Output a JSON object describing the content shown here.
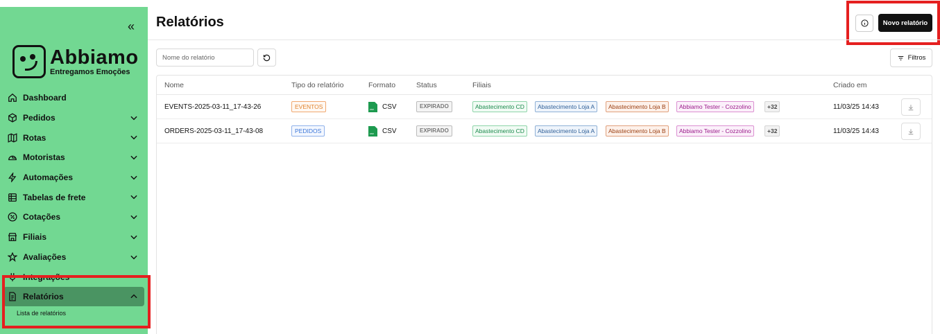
{
  "sidebar": {
    "brand": {
      "name": "Abbiamo",
      "tagline": "Entregamos Emoções"
    },
    "items": [
      {
        "label": "Dashboard",
        "icon": "home-icon"
      },
      {
        "label": "Pedidos",
        "icon": "package-icon"
      },
      {
        "label": "Rotas",
        "icon": "map-icon"
      },
      {
        "label": "Motoristas",
        "icon": "helmet-icon"
      },
      {
        "label": "Automações",
        "icon": "lightning-icon"
      },
      {
        "label": "Tabelas de frete",
        "icon": "table-icon"
      },
      {
        "label": "Cotações",
        "icon": "percent-icon"
      },
      {
        "label": "Filiais",
        "icon": "store-icon"
      },
      {
        "label": "Avaliações",
        "icon": "star-icon"
      },
      {
        "label": "Integrações",
        "icon": "plug-icon"
      },
      {
        "label": "Relatórios",
        "icon": "document-icon"
      }
    ],
    "subitem": "Lista de relatórios"
  },
  "header": {
    "title": "Relatórios",
    "new_button": "Novo relatório"
  },
  "toolbar": {
    "search_placeholder": "Nome do relatório",
    "filters_label": "Filtros"
  },
  "table": {
    "columns": [
      "Nome",
      "Tipo do relatório",
      "Formato",
      "Status",
      "Filiais",
      "Criado em"
    ],
    "rows": [
      {
        "name": "EVENTS-2025-03-11_17-43-26",
        "type": "EVENTOS",
        "format": "CSV",
        "status": "EXPIRADO",
        "branches": [
          "Abastecimento CD",
          "Abastecimento Loja A",
          "Abastecimento Loja B",
          "Abbiamo Tester - Cozzolino",
          "+32"
        ],
        "created": "11/03/25 14:43"
      },
      {
        "name": "ORDERS-2025-03-11_17-43-08",
        "type": "PEDIDOS",
        "format": "CSV",
        "status": "EXPIRADO",
        "branches": [
          "Abastecimento CD",
          "Abastecimento Loja A",
          "Abastecimento Loja B",
          "Abbiamo Tester - Cozzolino",
          "+32"
        ],
        "created": "11/03/25 14:43"
      }
    ]
  },
  "colors": {
    "sidebar_bg": "#72d892",
    "active_bg": "#4a9462",
    "highlight": "#e51f1f"
  }
}
